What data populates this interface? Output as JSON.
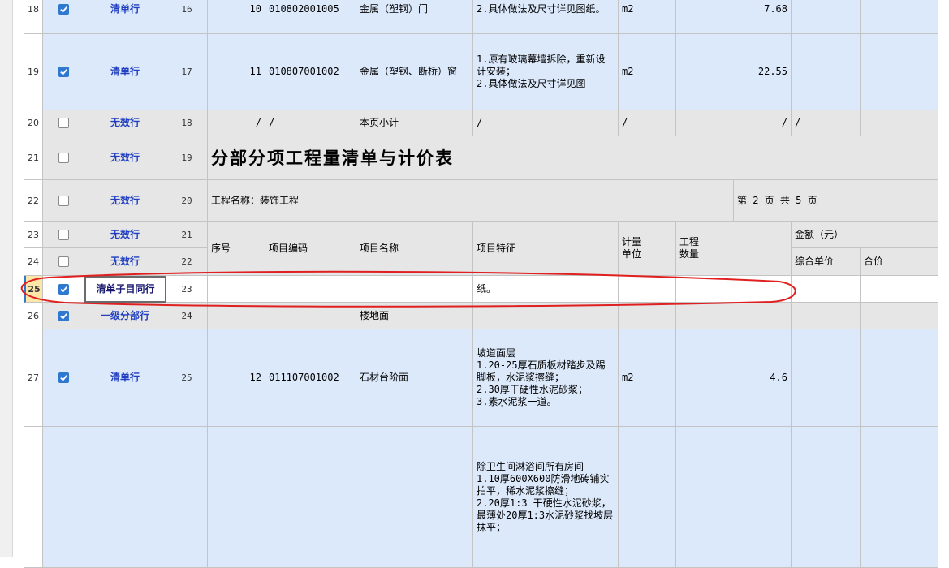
{
  "colors": {
    "blue_row": "#dce9fb",
    "gray_row": "#e6e6e6",
    "white_row": "#ffffff",
    "type_text": "#1f3ec0",
    "checkbox_on": "#2f78d0",
    "annotation": "#e02020"
  },
  "rows": [
    {
      "num": "18",
      "checked": true,
      "type": "清单行",
      "sn": "16",
      "bg": "blue",
      "cells": [
        "10",
        "010802001005",
        "金属（塑钢）门",
        "2.具体做法及尺寸详见图纸。",
        "m2",
        "7.68",
        "",
        ""
      ]
    },
    {
      "num": "19",
      "checked": true,
      "type": "清单行",
      "sn": "17",
      "bg": "blue",
      "cells": [
        "11",
        "010807001002",
        "金属（塑钢、断桥）窗",
        "1.原有玻璃幕墙拆除，重新设计安装；\n2.具体做法及尺寸详见图",
        "m2",
        "22.55",
        "",
        ""
      ]
    },
    {
      "num": "20",
      "checked": false,
      "type": "无效行",
      "sn": "18",
      "bg": "gray",
      "cells": [
        "/",
        "/",
        "本页小计",
        "/",
        "/",
        "/",
        "/",
        ""
      ]
    },
    {
      "num": "21",
      "checked": false,
      "type": "无效行",
      "sn": "19",
      "bg": "gray",
      "title": "分部分项工程量清单与计价表"
    },
    {
      "num": "22",
      "checked": false,
      "type": "无效行",
      "sn": "20",
      "bg": "gray",
      "project": "工程名称：装饰工程",
      "page": "第 2 页  共 5 页"
    },
    {
      "num": "23",
      "checked": false,
      "type": "无效行",
      "sn": "21",
      "bg": "gray"
    },
    {
      "num": "24",
      "checked": false,
      "type": "无效行",
      "sn": "22",
      "bg": "gray"
    },
    {
      "num": "25",
      "checked": true,
      "type": "清单子目同行",
      "sn": "23",
      "bg": "white",
      "current": true,
      "cells": [
        "",
        "",
        "",
        "纸。",
        "",
        "",
        "",
        ""
      ]
    },
    {
      "num": "26",
      "checked": true,
      "type": "一级分部行",
      "sn": "24",
      "bg": "gray",
      "cells": [
        "",
        "",
        "楼地面",
        "",
        "",
        "",
        "",
        ""
      ]
    },
    {
      "num": "27",
      "checked": true,
      "type": "清单行",
      "sn": "25",
      "bg": "blue",
      "cells": [
        "12",
        "011107001002",
        "石材台阶面",
        "坡道面层\n1.20-25厚石质板材踏步及踢脚板，水泥浆擦缝；\n2.30厚干硬性水泥砂浆；\n3.素水泥浆一道。",
        "m2",
        "4.6",
        "",
        ""
      ]
    },
    {
      "num": "",
      "checked": false,
      "type": "",
      "sn": "",
      "bg": "blue",
      "nocheckbox": true,
      "cells": [
        "",
        "",
        "",
        "除卫生间淋浴间所有房间\n1.10厚600X600防滑地砖铺实拍平，稀水泥浆擦缝；\n2.20厚1:3 干硬性水泥砂浆，最薄处20厚1:3水泥砂浆找坡层抹平；",
        "",
        "",
        "",
        ""
      ]
    }
  ],
  "headers": {
    "seq": "序号",
    "code": "项目编码",
    "name": "项目名称",
    "feature": "项目特征",
    "unit": "计量\n单位",
    "qty": "工程\n数量",
    "amount": "金额（元）",
    "unit_price": "综合单价",
    "total": "合价"
  }
}
